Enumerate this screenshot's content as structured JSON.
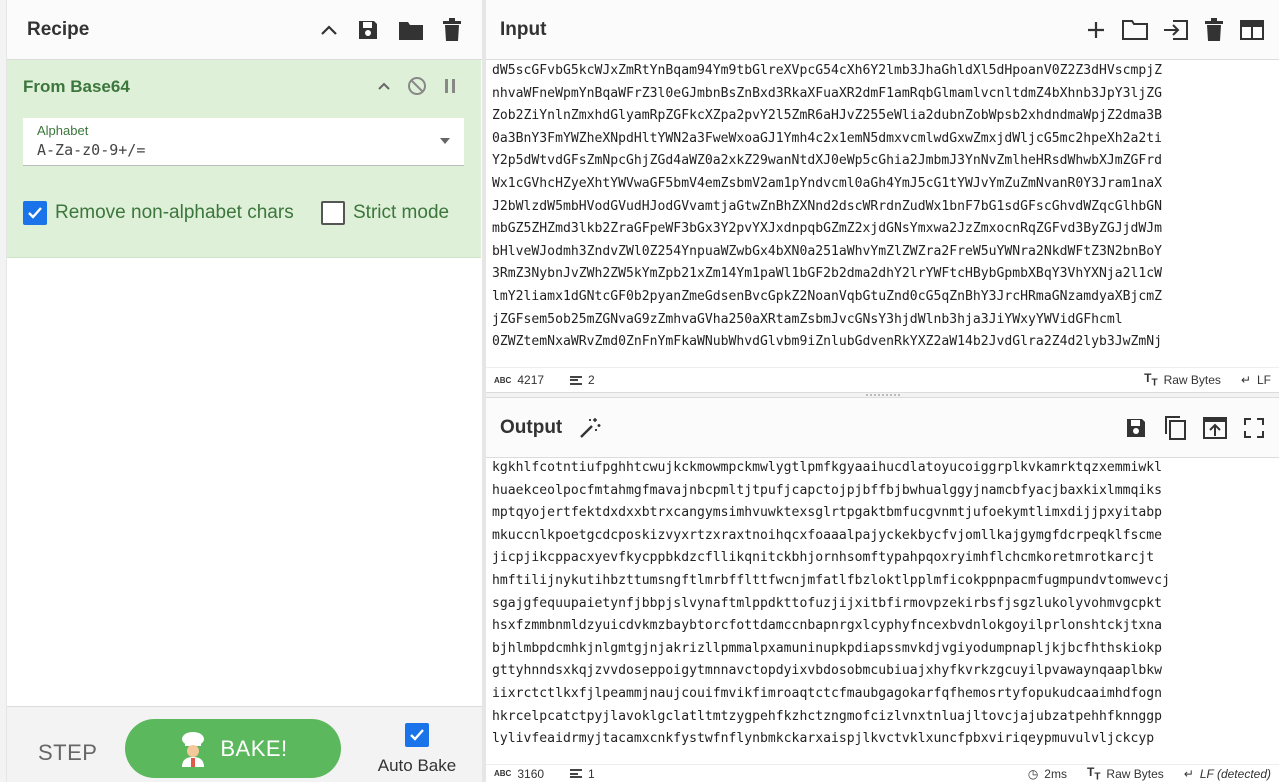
{
  "recipe": {
    "title": "Recipe",
    "operation": {
      "name": "From Base64",
      "alphabet_label": "Alphabet",
      "alphabet_value": "A-Za-z0-9+/=",
      "remove_nonalpha_label": "Remove non-alphabet chars",
      "remove_nonalpha_checked": true,
      "strict_mode_label": "Strict mode",
      "strict_mode_checked": false
    },
    "bake": {
      "step_label": "STEP",
      "bake_label": "BAKE!",
      "autobake_label": "Auto Bake",
      "autobake_checked": true
    }
  },
  "input": {
    "title": "Input",
    "lines": [
      "dW5scGFvbG5kcWJxZmRtYnBqam94Ym9tbGlreXVpcG54cXh6Y2lmb3JhaGhldXl5dHpoanV0Z2Z3dHVscmpjZ",
      "nhvaWFneWpmYnBqaWFrZ3l0eGJmbnBsZnBxd3RkaXFuaXR2dmF1amRqbGlmamlvcnltdmZ4bXhnb3JpY3ljZG",
      "Zob2ZiYnlnZmxhdGlyamRpZGFkcXZpa2pvY2l5ZmR6aHJvZ255eWlia2dubnZobWpsb2xhdndmaWpjZ2dma3B",
      "0a3BnY3FmYWZheXNpdHltYWN2a3FweWxoaGJ1Ymh4c2x1emN5dmxvcmlwdGxwZmxjdWljcG5mc2hpeXh2a2ti",
      "Y2p5dWtvdGFsZmNpcGhjZGd4aWZ0a2xkZ29wanNtdXJ0eWp5cGhia2JmbmJ3YnNvZmlheHRsdWhwbXJmZGFrd",
      "Wx1cGVhcHZyeXhtYWVwaGF5bmV4emZsbmV2am1pYndvcml0aGh4YmJ5cG1tYWJvYmZuZmNvanR0Y3Jram1naX",
      "J2bWlzdW5mbHVodGVudHJodGVvamtjaGtwZnBhZXNnd2dscWRrdnZudWx1bnF7bG1sdGFscGhvdWZqcGlhbGN",
      "mbGZ5ZHZmd3lkb2ZraGFpeWF3bGx3Y2pvYXJxdnpqbGZmZ2xjdGNsYmxwa2JzZmxocnRqZGFvd3ByZGJjdWJm",
      "bHlveWJodmh3ZndvZWl0Z254YnpuaWZwbGx4bXN0a251aWhvYmZlZWZra2FreW5uYWNra2NkdWFtZ3N2bnBoY",
      "3RmZ3NybnJvZWh2ZW5kYmZpb21xZm14Ym1paWl1bGF2b2dma2dhY2lrYWFtcHBybGpmbXBqY3VhYXNja2l1cW",
      "lmY2liamx1dGNtcGF0b2pyanZmeGdsenBvcGpkZ2NoanVqbGtuZnd0cG5qZnBhY3JrcHRmaGNzamdyaXBjcmZ",
      "jZGFsem5ob25mZGNvaG9zZmhvaGVha250aXRtamZsbmJvcGNsY3hjdWlnb3hja3JiYWxyYWVidGFhcml",
      "0ZWZtemNxaWRvZmd0ZnFnYmFkaWNubWhvdGlvbm9iZnlubGdvenRkYXZ2aW14b2JvdGlra2Z4d2lyb3JwZmNj"
    ],
    "char_count": "4217",
    "line_count": "2",
    "encoding": "Raw Bytes",
    "eol": "LF"
  },
  "output": {
    "title": "Output",
    "lines": [
      "kgkhlfcotntiufpghhtcwujkckmowmpckmwlygtlpmfkgyaaihucdlatoyucoiggrplkvkamrktqzxemmiwkl",
      "huaekceolpocfmtahmgfmavajnbcpmltjtpufjcapctojpjbffbjbwhualggyjnamcbfyacjbaxkixlmmqiks",
      "mptqyojertfektdxdxxbtrxcangymsimhvuwktexsglrtpgaktbmfucgvnmtjufoekymtlimxdijjpxyitabp",
      "mkuccnlkpoetgcdcposkizvyxrtzxraxtnoihqcxfoaaalpajyckekbycfvjomllkajgymgfdcrpeqklfscme",
      "jicpjikcppacxyevfkycppbkdzcfllikqnitckbhjornhsomftypahpqoxryimhflchcmkoretmrotkarcjt",
      "hmftilijnykutihbzttumsngftlmrbfflttfwcnjmfatlfbzloktlpplmficokppnpacmfugmpundvtomwevcj",
      "sgajgfequupaietynfjbbpjslvynaftmlppdkttofuzjijxitbfirmovpzekirbsfjsgzlukolyvohmvgcpkt",
      "hsxfzmmbnmldzyuicdvkmzbaybtorcfottdamccnbapnrgxlcyphyfncexbvdnlokgoyilprlonshtckjtxna",
      "bjhlmbpdcmhkjnlgmtgjnjakrizllpmmalpxamuninupkpdiapssmvkdjvgiyodumpnapljkjbcfhthskiokp",
      "gttyhnndsxkqjzvvdoseppoigytmnnavctopdyixvbdosobmcubiuajxhyfkvrkzgcuyilpvawaynqaaplbkw",
      "iixrctctlkxfjlpeammjnaujcouifmvikfimroaqtctcfmaubgagokarfqfhemosrtyfopukudcaaimhdfogn",
      "hkrcelpcatctpyjlavoklgclatltmtzygpehfkzhctzngmofcizlvnxtnluajltovcjajubzatpehhfknnggp",
      "lylivfeaidrmyjtacamxcnkfystwfnflynbmkckarxaispjlkvctvklxuncfpbxviriqeypmuvulvljckcyp"
    ],
    "char_count": "3160",
    "line_count": "1",
    "time": "2ms",
    "encoding": "Raw Bytes",
    "eol": "LF (detected)"
  },
  "colors": {
    "accent_green": "#5cb85c",
    "op_bg": "#dff0d8",
    "op_text": "#3c763d",
    "checkbox_blue": "#1a73e8"
  }
}
